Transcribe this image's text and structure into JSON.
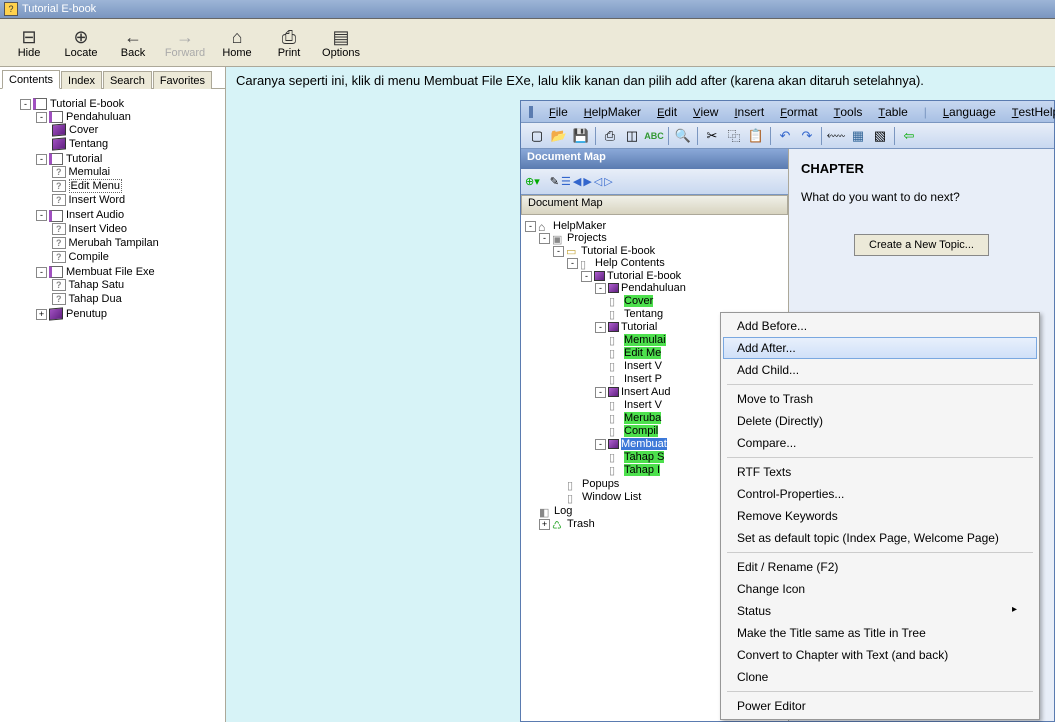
{
  "window": {
    "title": "Tutorial E-book"
  },
  "toolbar": [
    {
      "id": "hide",
      "label": "Hide",
      "glyph": "⊟",
      "enabled": true
    },
    {
      "id": "locate",
      "label": "Locate",
      "glyph": "⊕",
      "enabled": true
    },
    {
      "id": "back",
      "label": "Back",
      "glyph": "←",
      "enabled": true
    },
    {
      "id": "forward",
      "label": "Forward",
      "glyph": "→",
      "enabled": false
    },
    {
      "id": "home",
      "label": "Home",
      "glyph": "⌂",
      "enabled": true
    },
    {
      "id": "print",
      "label": "Print",
      "glyph": "⎙",
      "enabled": true
    },
    {
      "id": "options",
      "label": "Options",
      "glyph": "▤",
      "enabled": true
    }
  ],
  "navtabs": [
    "Contents",
    "Index",
    "Search",
    "Favorites"
  ],
  "navtabs_active": 0,
  "tree": {
    "root": "Tutorial E-book",
    "nodes": [
      {
        "label": "Pendahuluan",
        "type": "book",
        "children": [
          {
            "label": "Cover",
            "type": "pbook"
          },
          {
            "label": "Tentang",
            "type": "pbook"
          }
        ]
      },
      {
        "label": "Tutorial",
        "type": "book",
        "children": [
          {
            "label": "Memulai",
            "type": "q"
          },
          {
            "label": "Edit Menu",
            "type": "q",
            "selected": true
          },
          {
            "label": "Insert Word",
            "type": "q"
          }
        ]
      },
      {
        "label": "Insert Audio",
        "type": "book",
        "children": [
          {
            "label": "Insert Video",
            "type": "q"
          },
          {
            "label": "Merubah Tampilan",
            "type": "q"
          },
          {
            "label": "Compile",
            "type": "q"
          }
        ]
      },
      {
        "label": "Membuat File Exe",
        "type": "book",
        "children": [
          {
            "label": "Tahap Satu",
            "type": "q"
          },
          {
            "label": "Tahap Dua",
            "type": "q"
          }
        ]
      },
      {
        "label": "Penutup",
        "type": "pbook",
        "collapsed": true
      }
    ]
  },
  "description": "Caranya seperti ini, klik di menu Membuat File EXe, lalu klik kanan dan pilih add after (karena akan ditaruh setelahnya).",
  "helpmaker": {
    "menu": [
      "File",
      "HelpMaker",
      "Edit",
      "View",
      "Insert",
      "Format",
      "Tools",
      "Table",
      "Language",
      "TestHelp"
    ],
    "docmap_title": "Document Map",
    "docmap_header": "Document Map",
    "tree": {
      "root": "HelpMaker",
      "projects": "Projects",
      "project": "Tutorial E-book",
      "helpcontents": "Help Contents",
      "book": "Tutorial E-book",
      "items": [
        {
          "label": "Pendahuluan",
          "children": [
            {
              "label": "Cover",
              "hl": "green",
              "sel": true
            },
            {
              "label": "Tentang"
            }
          ]
        },
        {
          "label": "Tutorial",
          "children": [
            {
              "label": "Memulai",
              "hl": "green"
            },
            {
              "label": "Edit Me",
              "hl": "green"
            },
            {
              "label": "Insert V"
            },
            {
              "label": "Insert P"
            }
          ]
        },
        {
          "label": "Insert Aud",
          "children": [
            {
              "label": "Insert V"
            },
            {
              "label": "Meruba",
              "hl": "green"
            },
            {
              "label": "Compil",
              "hl": "green"
            }
          ]
        },
        {
          "label": "Membuat",
          "hl": "sel",
          "children": [
            {
              "label": "Tahap S",
              "hl": "green"
            },
            {
              "label": "Tahap I",
              "hl": "green"
            }
          ]
        }
      ],
      "popups": "Popups",
      "windowlist": "Window List",
      "log": "Log",
      "trash": "Trash"
    },
    "rightpanel": {
      "heading": "CHAPTER",
      "question": "What do you want to do next?",
      "button": "Create a New Topic..."
    }
  },
  "contextmenu": {
    "groups": [
      [
        "Add Before...",
        "Add After...",
        "Add Child..."
      ],
      [
        "Move to Trash",
        "Delete (Directly)",
        "Compare..."
      ],
      [
        "RTF Texts",
        "Control-Properties...",
        "Remove Keywords",
        "Set as default topic (Index Page, Welcome Page)"
      ],
      [
        "Edit / Rename (F2)",
        "Change Icon",
        "Status",
        "Make the Title same as Title in Tree",
        "Convert to Chapter with Text (and back)",
        "Clone"
      ],
      [
        "Power Editor"
      ]
    ],
    "hovered": "Add After...",
    "submenu_on": "Status"
  }
}
